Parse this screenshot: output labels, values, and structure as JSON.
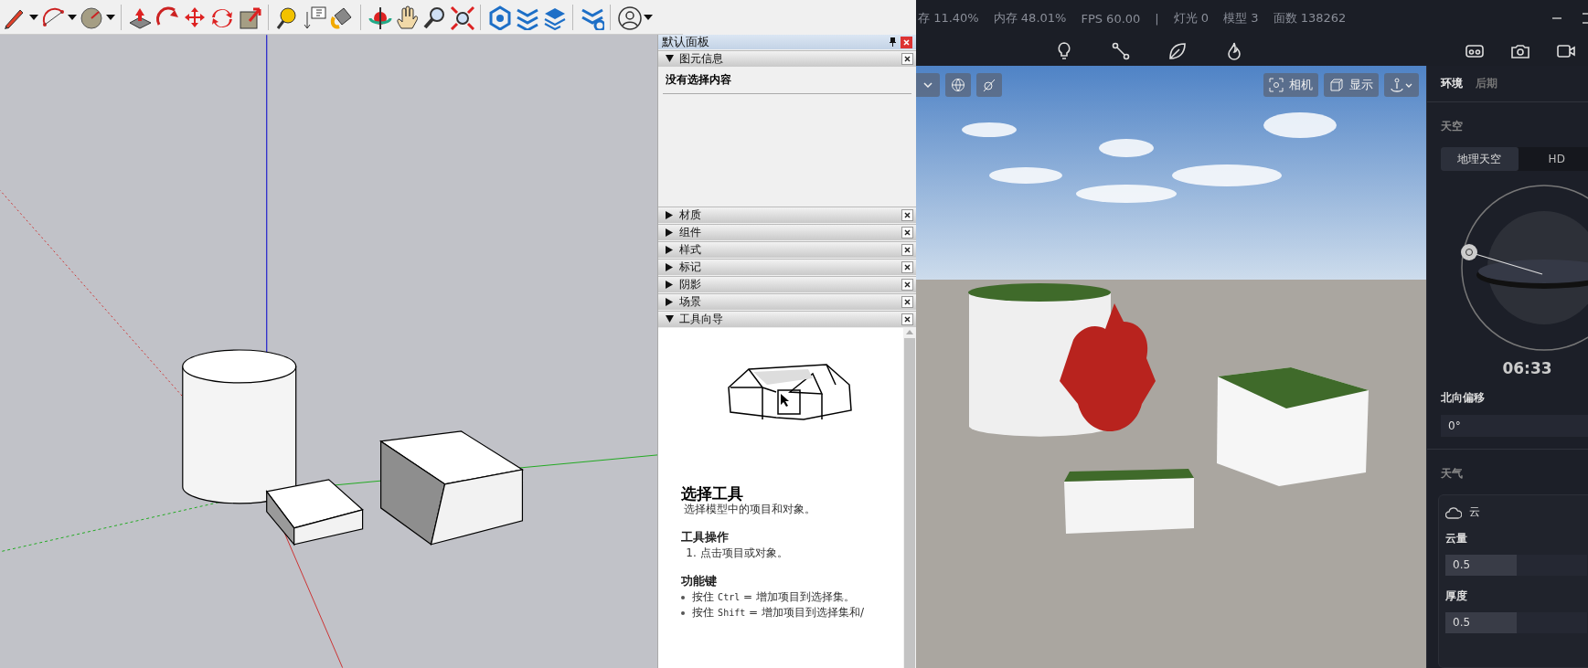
{
  "modeling_app": {
    "tray": {
      "title": "默认面板",
      "sections": [
        {
          "title": "图元信息",
          "expanded": true,
          "kind": "entity_info",
          "message": "没有选择内容"
        },
        {
          "title": "材质",
          "expanded": false
        },
        {
          "title": "组件",
          "expanded": false
        },
        {
          "title": "样式",
          "expanded": false
        },
        {
          "title": "标记",
          "expanded": false
        },
        {
          "title": "阴影",
          "expanded": false
        },
        {
          "title": "场景",
          "expanded": false
        },
        {
          "title": "工具向导",
          "expanded": true,
          "kind": "instructor",
          "tool_title": "选择工具",
          "tool_description": "选择模型中的项目和对象。",
          "operations_heading": "工具操作",
          "operations": [
            "1. 点击项目或对象。"
          ],
          "modifiers_heading": "功能键",
          "modifiers": [
            {
              "prefix": "按住",
              "key": "Ctrl",
              "text": "= 增加项目到选择集。"
            },
            {
              "prefix": "按住",
              "key": "Shift",
              "text": "= 增加项目到选择集和/"
            }
          ]
        }
      ]
    }
  },
  "render_app": {
    "stats": [
      "存 11.40%",
      "内存 48.01%",
      "FPS 60.00",
      "|",
      "灯光 0",
      "模型 3",
      "面数 138262"
    ],
    "viewport": {
      "camera_button": "相机",
      "display_button": "显示"
    },
    "side_panel": {
      "tabs": [
        {
          "label": "环境",
          "selected": true
        },
        {
          "label": "后期",
          "selected": false
        }
      ],
      "sky_heading": "天空",
      "sky_modes": [
        {
          "label": "地理天空",
          "selected": true
        },
        {
          "label": "HD",
          "selected": false
        }
      ],
      "time": "06:33",
      "north_offset": {
        "label": "北向偏移",
        "value": "0°"
      },
      "weather_heading": "天气",
      "cloud": {
        "label": "云",
        "sliders": [
          {
            "label": "云量",
            "value": "0.5",
            "level": 0.5
          },
          {
            "label": "厚度",
            "value": "0.5",
            "level": 0.5
          }
        ]
      }
    }
  }
}
